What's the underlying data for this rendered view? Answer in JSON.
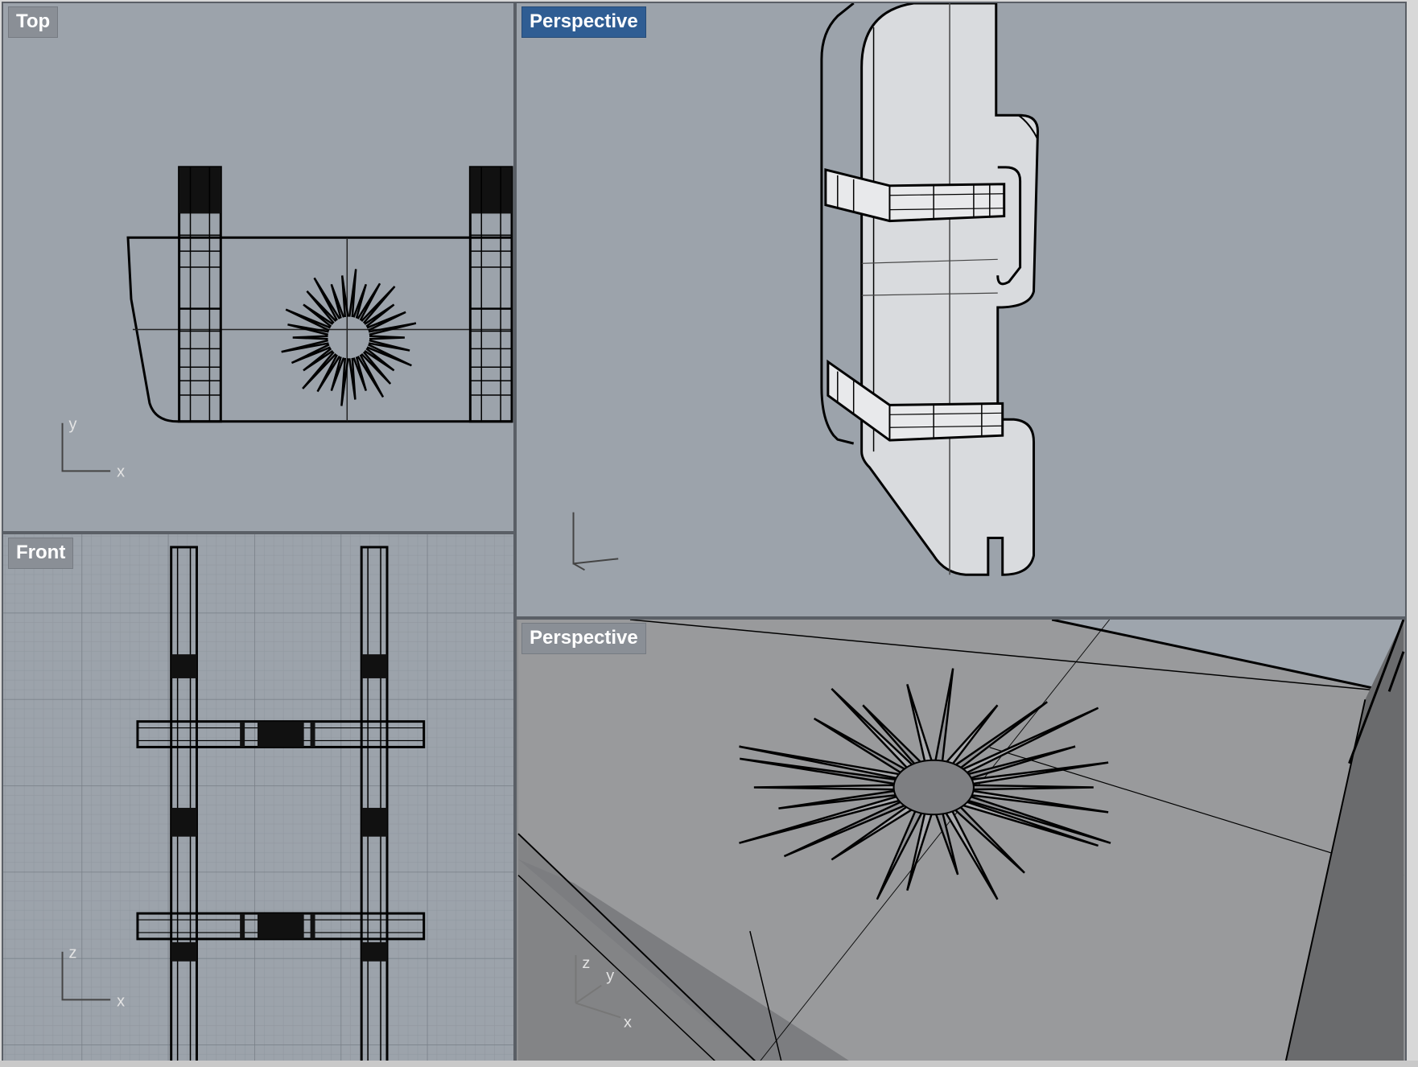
{
  "viewports": {
    "top": {
      "label": "Top",
      "axes": [
        "x",
        "y"
      ],
      "active": false
    },
    "front": {
      "label": "Front",
      "axes": [
        "x",
        "z"
      ],
      "active": false
    },
    "perspective_top": {
      "label": "Perspective",
      "axes": [],
      "active": true
    },
    "perspective_bottom": {
      "label": "Perspective",
      "axes": [
        "x",
        "y",
        "z"
      ],
      "active": false
    }
  },
  "colors": {
    "viewport_bg": "#9ca3ab",
    "active_tag": "#2f5d93",
    "inactive_tag": "#8a8f96",
    "wire": "#000000",
    "grid": "#8d949c"
  }
}
